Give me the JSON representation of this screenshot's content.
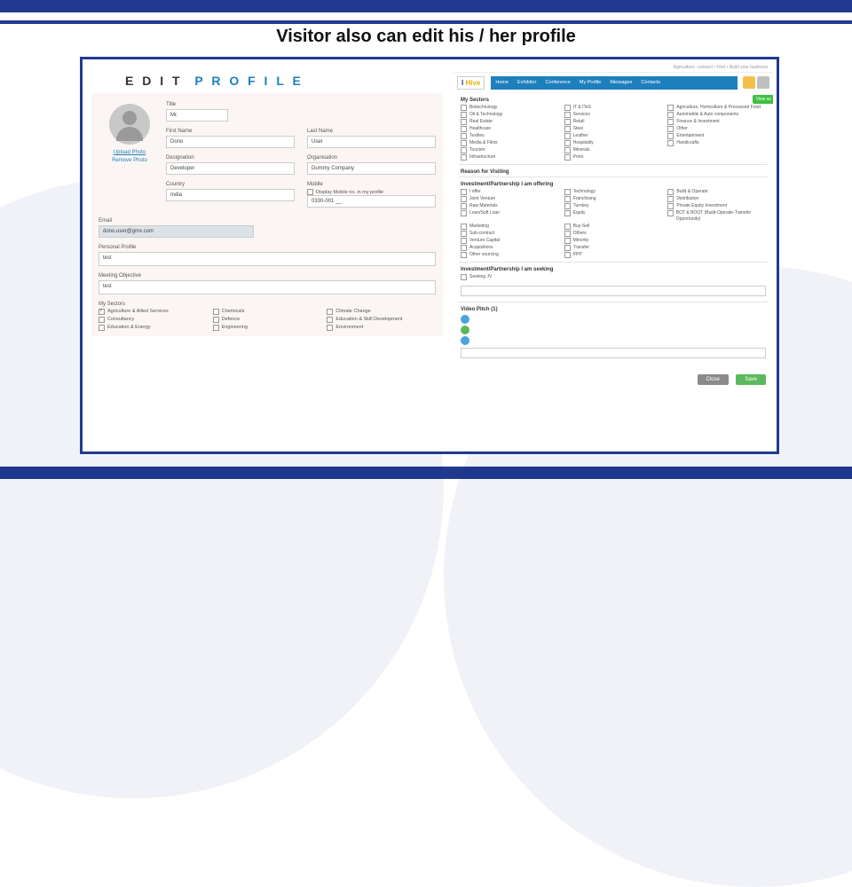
{
  "slide_title": "Visitor also can edit his / her profile",
  "left": {
    "header_edit": "E D I T",
    "header_profile": "P R O F I L E",
    "upload": "Upload Photo",
    "remove": "Remove Photo",
    "title_lbl": "Title",
    "title_val": "Mr.",
    "first_lbl": "First Name",
    "first_val": "Dono",
    "last_lbl": "Last Name",
    "last_val": "User",
    "desig_lbl": "Designation",
    "desig_val": "Developer",
    "org_lbl": "Organisation",
    "org_val": "Dummy Company",
    "country_lbl": "Country",
    "country_val": "India",
    "mobile_lbl": "Mobile",
    "mobile_chk": "Display Mobile no. in my profile",
    "mobile_val": "0330-001 __",
    "email_lbl": "Email",
    "email_val": "dono.user@gmx.com",
    "personal_lbl": "Personal Profile",
    "personal_val": "test",
    "obj_lbl": "Meeting Objective",
    "obj_val": "test",
    "sectors_lbl": "My Sectors",
    "sectors": [
      "Agriculture & Allied Services",
      "Chemicals",
      "Climate Change",
      "Consultancy",
      "Defence",
      "Education & Skill Development",
      "Education & Energy",
      "Engineering",
      "Environment"
    ],
    "sectors_checked": [
      true,
      false,
      false,
      false,
      false,
      false,
      false,
      false,
      false
    ]
  },
  "right": {
    "top_note": "Agriculture: connect • Find • Build your business",
    "logo_1": "I",
    "logo_2": "Hive",
    "tabs": [
      "Home",
      "Exhibitor",
      "Conference",
      "My Profile",
      "Messages",
      "Contacts"
    ],
    "green_pill": "View as",
    "sec_sectors": "My Sectors",
    "sectors_cols": [
      [
        "Biotechnology",
        "IT & ITeS",
        "Agriculture, Horticulture & Processed Food"
      ],
      [
        "Oil & Technology",
        "Services",
        "Automobile & Auto components"
      ],
      [
        "Real Estate",
        "Retail",
        "Finance & Investment"
      ],
      [
        "Healthcare",
        "Steel",
        "Other"
      ],
      [
        "Textiles",
        "Leather",
        "Entertainment"
      ],
      [
        "Media & Films",
        "Hospitality",
        "Handicrafts"
      ],
      [
        "Tourism",
        "Minerals",
        ""
      ],
      [
        "Infrastructure",
        "Ports",
        ""
      ]
    ],
    "reason_lbl": "Reason for Visiting",
    "offer_lbl": "Investment/Partnership I am offering",
    "offer_cols": [
      [
        "I offer",
        "Technology",
        "Build & Operate"
      ],
      [
        "Joint Venture",
        "Franchising",
        "Distribution"
      ],
      [
        "Raw Materials",
        "Turnkey",
        "Private Equity Investment"
      ],
      [
        "Loan/Soft Loan",
        "Equity",
        "BOT & BOOT (Build-Operate-Transfer Opportunity)"
      ],
      [
        "Marketing",
        "Buy-Sell",
        ""
      ],
      [
        "Sub-contract",
        "Others",
        ""
      ],
      [
        "Venture Capital",
        "Minority",
        ""
      ],
      [
        "Acquisitions",
        "Transfer",
        ""
      ],
      [
        "Other sourcing",
        "PPP",
        ""
      ]
    ],
    "seek_lbl": "Investment/Partnership I am seeking",
    "seek_cols": [
      [
        "Seeking JV",
        "",
        ""
      ]
    ],
    "video_lbl": "Video Pitch (1)",
    "video_items": [
      "",
      "",
      ""
    ],
    "btn_close": "Close",
    "btn_save": "Save"
  }
}
